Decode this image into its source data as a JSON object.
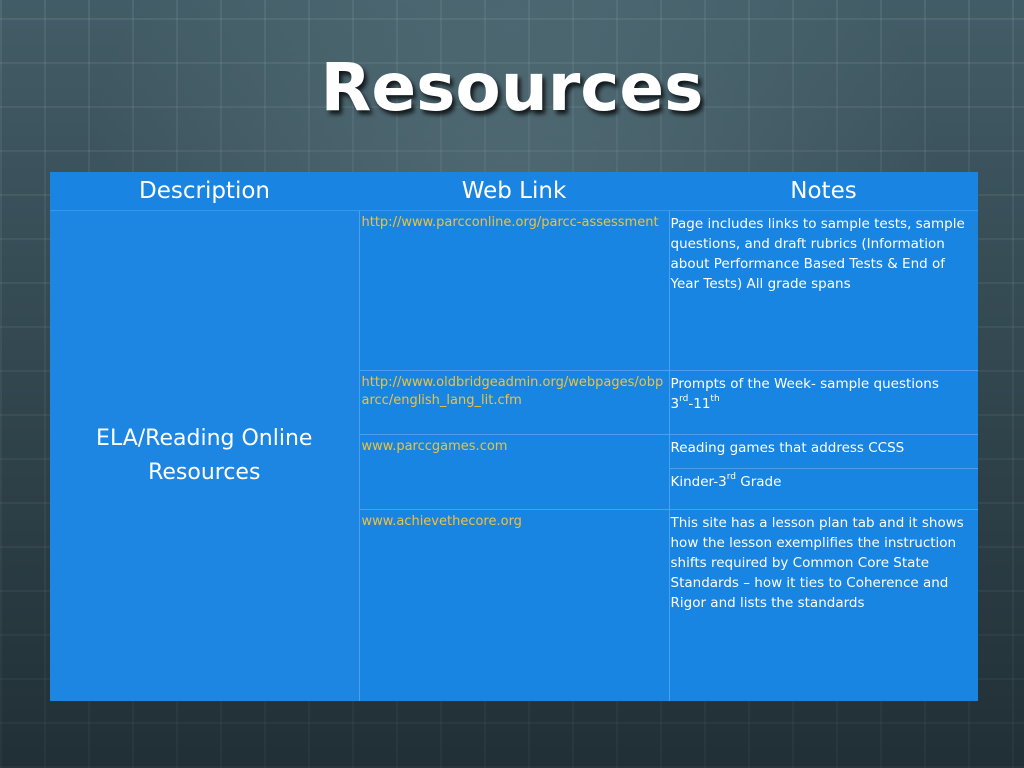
{
  "slide": {
    "title": "Resources"
  },
  "table": {
    "headers": {
      "description": "Description",
      "web_link": "Web Link",
      "notes": "Notes"
    },
    "description": "ELA/Reading Online Resources",
    "rows": [
      {
        "link": "http://www.parcconline.org/parcc-assessment",
        "note": "Page includes links to sample tests, sample questions, and draft rubrics (Information about Performance Based Tests & End of Year Tests) All grade spans"
      },
      {
        "link": "http://www.oldbridgeadmin.org/webpages/obparcc/english_lang_lit.cfm",
        "note_text": "Prompts of the Week- sample questions",
        "note_grade_start": "3",
        "note_grade_start_sup": "rd",
        "note_grade_sep": "-11",
        "note_grade_end_sup": "th"
      },
      {
        "link": "www.parccgames.com",
        "note": "Reading games that address CCSS",
        "note2_prefix": "Kinder-3",
        "note2_sup": "rd",
        "note2_suffix": " Grade"
      },
      {
        "link": "www.achievethecore.org",
        "note": "This site has a lesson plan tab and it shows how the lesson exemplifies the instruction shifts required by Common Core State Standards – how it ties to Coherence and Rigor and lists the standards"
      }
    ]
  },
  "colors": {
    "table_bg": "#1d86e3",
    "link_text": "#f0c23a",
    "text": "#ffffff"
  }
}
